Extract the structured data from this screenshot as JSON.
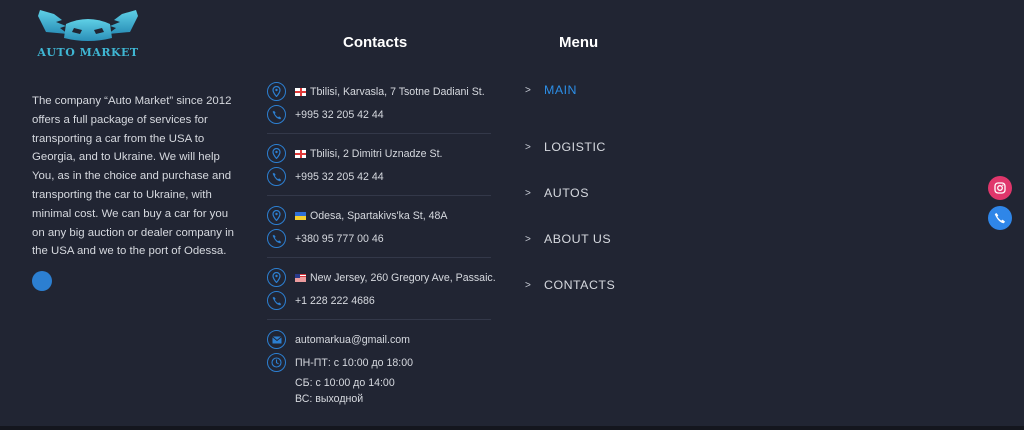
{
  "brand": {
    "name": "AUTO MARKET",
    "description": "The company “Auto Market” since 2012 offers a full package of services for transporting a car from the USA to Georgia, and to Ukraine. We will help You, as in the choice and purchase and transporting the car to Ukraine, with minimal cost. We can buy a car for you on any big auction or dealer company in the USA and we to the port of Odessa.",
    "accent_color": "#3fb6d3"
  },
  "contacts": {
    "heading": "Contacts",
    "offices": [
      {
        "flag": "georgia-flag-icon",
        "address": "Tbilisi, Karvasla, 7 Tsotne Dadiani St.",
        "phone": "+995 32 205 42 44"
      },
      {
        "flag": "georgia-flag-icon",
        "address": "Tbilisi, 2 Dimitri Uznadze St.",
        "phone": "+995 32 205 42 44"
      },
      {
        "flag": "ukraine-flag-icon",
        "address": "Odesa, Spartakivs'ka St, 48A",
        "phone": "+380 95 777 00 46"
      },
      {
        "flag": "usa-flag-icon",
        "address": "New Jersey, 260 Gregory Ave, Passaic.",
        "phone": "+1 228 222 4686"
      }
    ],
    "email": "automarkua@gmail.com",
    "hours": [
      "ПН-ПТ: с 10:00 до 18:00",
      "СБ: с 10:00 до 14:00",
      "ВС: выходной"
    ],
    "icons": {
      "location": "map-pin-icon",
      "phone": "phone-icon",
      "email": "envelope-icon",
      "hours": "clock-icon"
    }
  },
  "menu": {
    "heading": "Menu",
    "items": [
      {
        "label": "MAIN",
        "active": true
      },
      {
        "label": "LOGISTIC",
        "active": false
      },
      {
        "label": "AUTOS",
        "active": false
      },
      {
        "label": "ABOUT US",
        "active": false
      },
      {
        "label": "CONTACTS",
        "active": false
      }
    ],
    "arrow": ">"
  },
  "floating": {
    "instagram": "instagram-icon",
    "phone": "phone-icon"
  },
  "colors": {
    "background": "#212533",
    "accent_blue": "#2c7fd1",
    "active_link": "#2c8ee6",
    "instagram": "#e0366b"
  }
}
